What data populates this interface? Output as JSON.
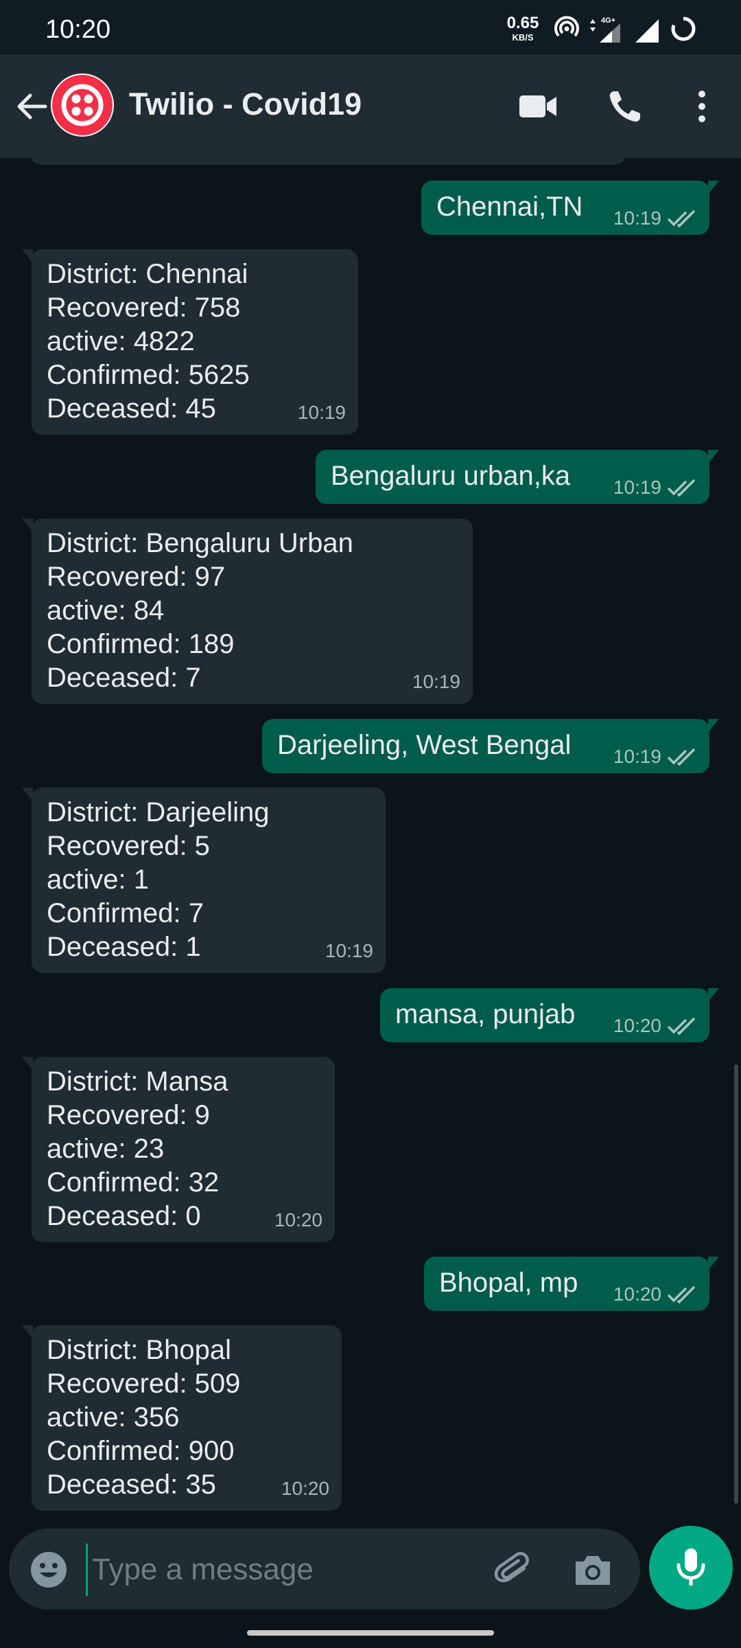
{
  "status_bar": {
    "time": "10:20",
    "net_speed": "0.65",
    "net_unit": "KB/S",
    "network_label": "4G+"
  },
  "header": {
    "title": "Twilio - Covid19"
  },
  "composer": {
    "placeholder": "Type a message"
  },
  "colors": {
    "background": "#0b141a",
    "header": "#202c33",
    "incoming_bubble": "#202c33",
    "outgoing_bubble": "#005c4b",
    "accent": "#00a884",
    "avatar_red": "#f22f46"
  },
  "messages": [
    {
      "direction": "out",
      "text": "Chennai,TN",
      "time": "10:19",
      "status": "read"
    },
    {
      "direction": "in",
      "lines": [
        "District: Chennai",
        "Recovered: 758",
        "active: 4822",
        "Confirmed: 5625",
        "Deceased: 45"
      ],
      "time": "10:19"
    },
    {
      "direction": "out",
      "text": "Bengaluru urban,ka",
      "time": "10:19",
      "status": "read"
    },
    {
      "direction": "in",
      "lines": [
        "District: Bengaluru Urban",
        "Recovered: 97",
        "active: 84",
        "Confirmed: 189",
        "Deceased: 7"
      ],
      "time": "10:19"
    },
    {
      "direction": "out",
      "text": "Darjeeling, West Bengal",
      "time": "10:19",
      "status": "read"
    },
    {
      "direction": "in",
      "lines": [
        "District: Darjeeling",
        "Recovered: 5",
        "active: 1",
        "Confirmed: 7",
        "Deceased: 1"
      ],
      "time": "10:19"
    },
    {
      "direction": "out",
      "text": "mansa, punjab",
      "time": "10:20",
      "status": "read"
    },
    {
      "direction": "in",
      "lines": [
        "District: Mansa",
        "Recovered: 9",
        "active: 23",
        "Confirmed: 32",
        "Deceased: 0"
      ],
      "time": "10:20"
    },
    {
      "direction": "out",
      "text": "Bhopal, mp",
      "time": "10:20",
      "status": "read"
    },
    {
      "direction": "in",
      "lines": [
        "District: Bhopal",
        "Recovered: 509",
        "active: 356",
        "Confirmed: 900",
        "Deceased: 35"
      ],
      "time": "10:20"
    }
  ]
}
